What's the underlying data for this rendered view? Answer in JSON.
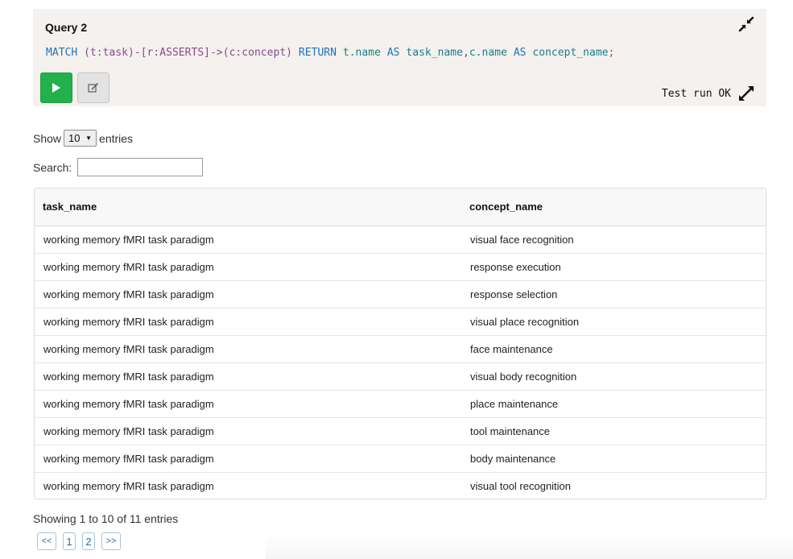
{
  "query": {
    "title": "Query 2",
    "code": {
      "match_kw": "MATCH",
      "pattern_1": "(t:task)-[r:ASSERTS]->(c:concept)",
      "return_kw": "RETURN",
      "field_1": "t.name",
      "as_kw_1": "AS",
      "alias_1": "task_name",
      "comma": ",",
      "field_2": "c.name",
      "as_kw_2": "AS",
      "alias_2": "concept_name",
      "semicolon": ";"
    },
    "status": "Test run OK",
    "icons": {
      "run": "play-icon",
      "edit": "edit-icon",
      "collapse": "compress-icon",
      "expand": "expand-icon"
    }
  },
  "length_control": {
    "show_label": "Show",
    "value": "10",
    "entries_label": "entries"
  },
  "search": {
    "label": "Search:",
    "value": ""
  },
  "table": {
    "columns": [
      "task_name",
      "concept_name"
    ],
    "rows": [
      [
        "working memory fMRI task paradigm",
        "visual face recognition"
      ],
      [
        "working memory fMRI task paradigm",
        "response execution"
      ],
      [
        "working memory fMRI task paradigm",
        "response selection"
      ],
      [
        "working memory fMRI task paradigm",
        "visual place recognition"
      ],
      [
        "working memory fMRI task paradigm",
        "face maintenance"
      ],
      [
        "working memory fMRI task paradigm",
        "visual body recognition"
      ],
      [
        "working memory fMRI task paradigm",
        "place maintenance"
      ],
      [
        "working memory fMRI task paradigm",
        "tool maintenance"
      ],
      [
        "working memory fMRI task paradigm",
        "body maintenance"
      ],
      [
        "working memory fMRI task paradigm",
        "visual tool recognition"
      ]
    ]
  },
  "info": "Showing 1 to 10 of 11 entries",
  "pagination": {
    "first": "<<",
    "pages": [
      "1",
      "2"
    ],
    "next": ">>"
  },
  "colors": {
    "run_button": "#22b14c",
    "keyword": "#1f72b8",
    "panel_bg": "#f4f1ee"
  }
}
